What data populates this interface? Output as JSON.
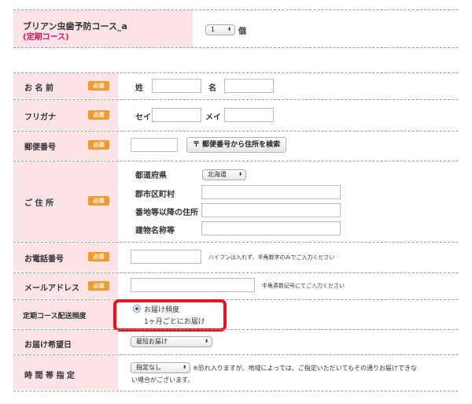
{
  "product": {
    "name": "ブリアン虫歯予防コース_a",
    "course": "(定期コース)",
    "quantity": "1",
    "unit": "個"
  },
  "required_badge": "必須",
  "name_row": {
    "label": "お 名 前",
    "sei_label": "姓",
    "mei_label": "名",
    "sei_value": "",
    "mei_value": ""
  },
  "kana_row": {
    "label": "フリガナ",
    "sei_label": "セイ",
    "mei_label": "メイ"
  },
  "postal_row": {
    "label": "郵便番号",
    "search_button": "〒 郵便番号から住所を検索"
  },
  "address_row": {
    "label": "ご 住 所",
    "prefecture_label": "都道府県",
    "prefecture_value": "北海道",
    "city_label": "郡市区町村",
    "street_label": "番地等以降の住所",
    "building_label": "建物名称等"
  },
  "phone_row": {
    "label": "お電話番号",
    "note": "ハイフンは入れず、半角数字のみでご入力ください"
  },
  "email_row": {
    "label": "メールアドレス",
    "note": "半角英数記号にてご入力ください"
  },
  "frequency_row": {
    "label": "定期コース配送頻度",
    "option_label": "お届け頻度",
    "option_value": "1ヶ月ごとにお届け"
  },
  "delivery_date_row": {
    "label": "お届け希望日",
    "select_value": "最短お届け"
  },
  "time_row": {
    "label": "時 間 帯 指 定",
    "select_value": "指定なし",
    "note_line1": "※恐れ入りますが、地域によっては、ご指定いただいてもその通りお届けできな",
    "note_line2": "い場合がございます。"
  },
  "colors": {
    "label_bg": "#fbe3e8",
    "required_badge": "#f39a2b",
    "highlight": "#e8141b"
  }
}
